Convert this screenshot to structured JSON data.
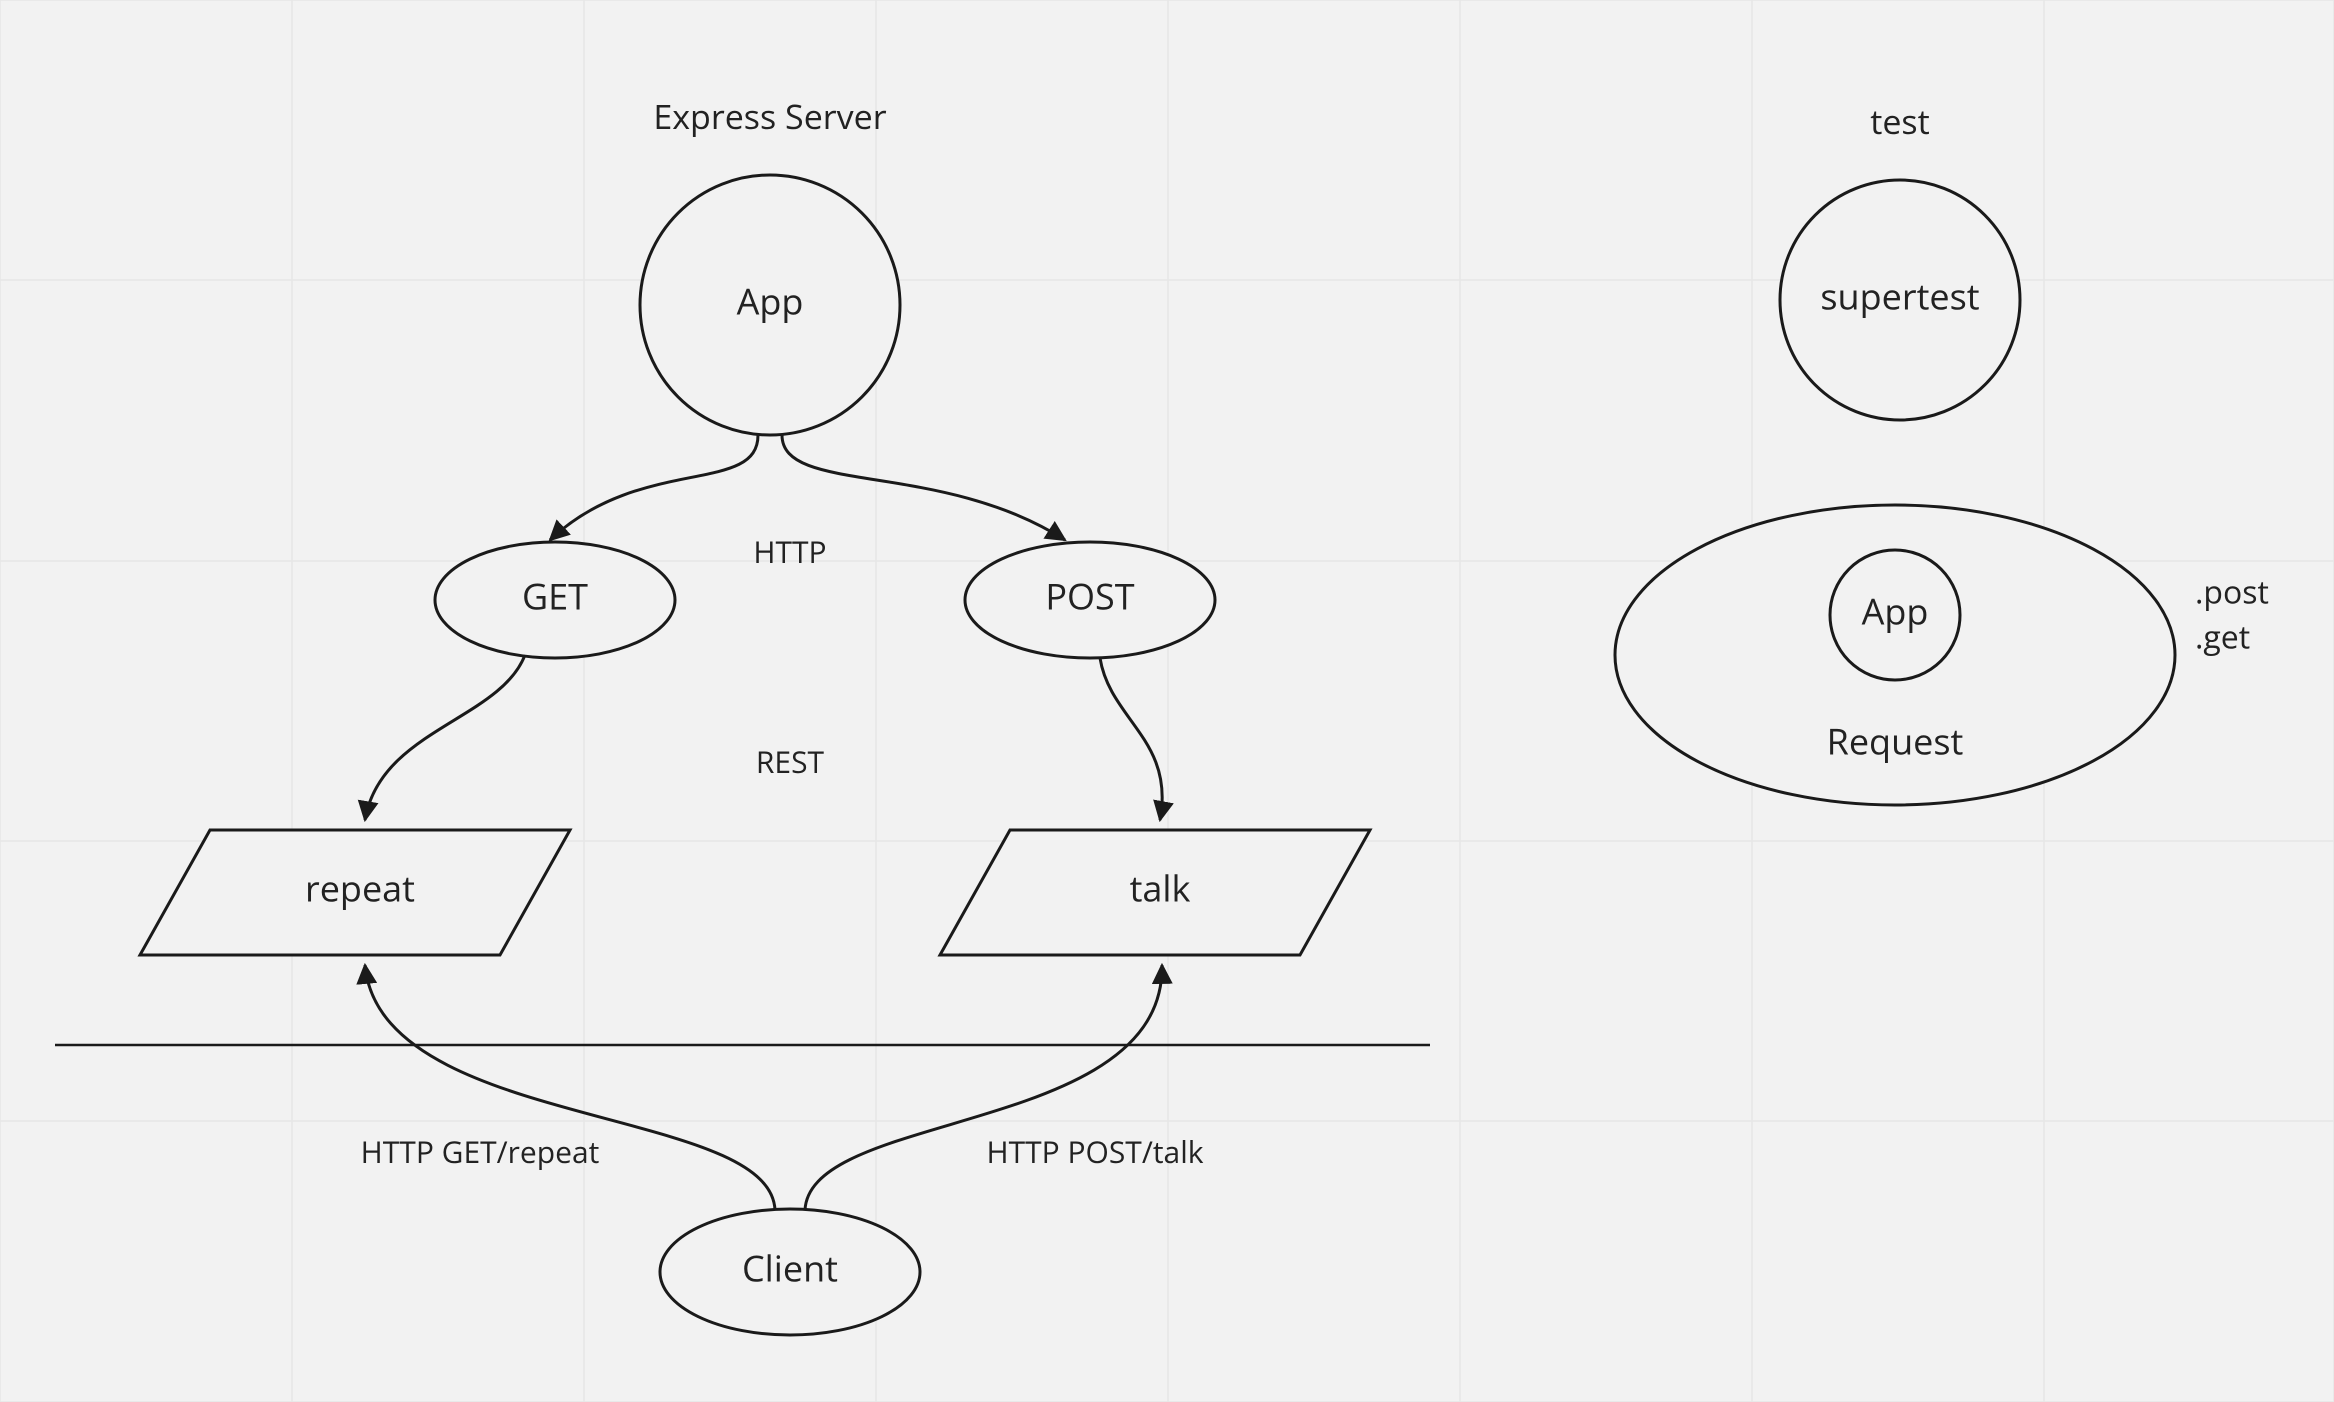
{
  "left": {
    "title": "Express Server",
    "app": "App",
    "get": "GET",
    "post": "POST",
    "httpLabel": "HTTP",
    "restLabel": "REST",
    "repeat": "repeat",
    "talk": "talk",
    "client": "Client",
    "clientGet": "HTTP GET/repeat",
    "clientPost": "HTTP POST/talk"
  },
  "right": {
    "title": "test",
    "supertest": "supertest",
    "app": "App",
    "request": "Request",
    "side1": ".post",
    "side2": ".get"
  }
}
